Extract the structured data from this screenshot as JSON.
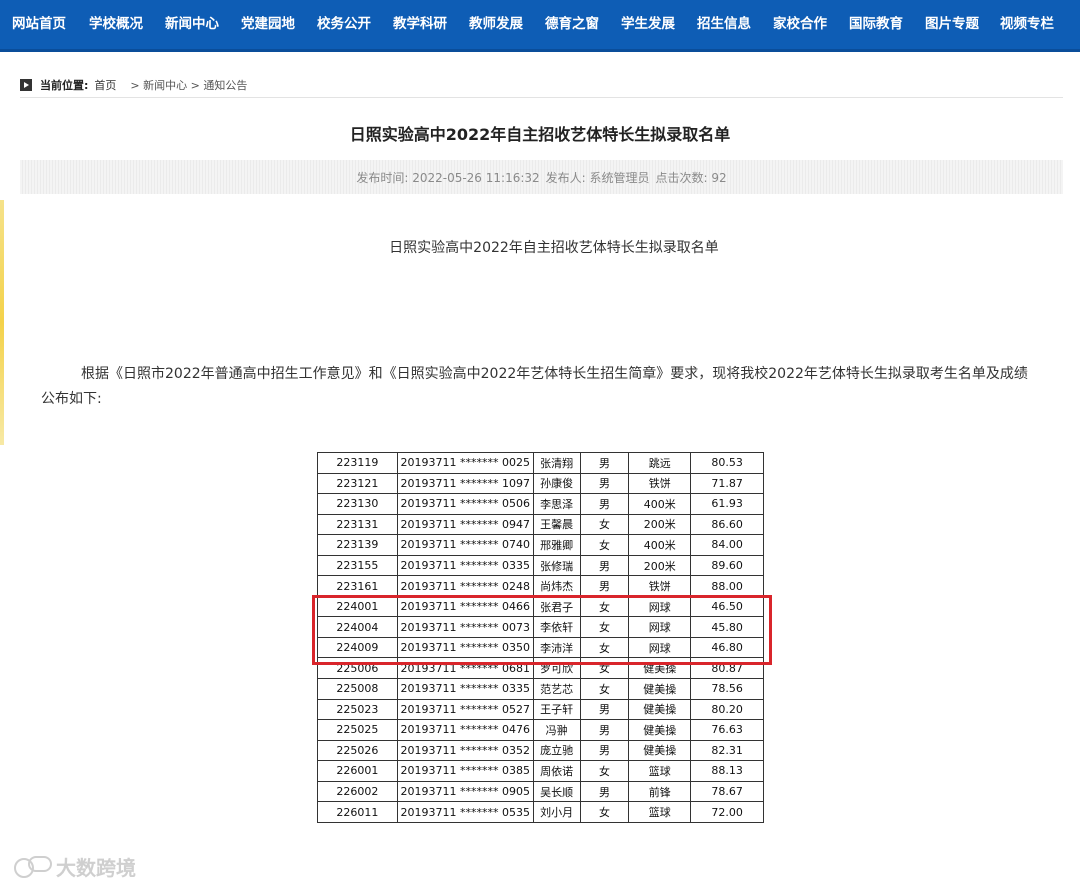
{
  "nav": {
    "items": [
      "网站首页",
      "学校概况",
      "新闻中心",
      "党建园地",
      "校务公开",
      "教学科研",
      "教师发展",
      "德育之窗",
      "学生发展",
      "招生信息",
      "家校合作",
      "国际教育",
      "图片专题",
      "视频专栏"
    ]
  },
  "breadcrumb": {
    "lead": "当前位置:",
    "home": "首页",
    "path": "> 新闻中心 > 通知公告"
  },
  "article": {
    "title": "日照实验高中2022年自主招收艺体特长生拟录取名单",
    "meta": {
      "publish_time": "发布时间: 2022-05-26 11:16:32",
      "publisher": "发布人: 系统管理员",
      "clicks": "点击次数: 92"
    },
    "subtitle": "日照实验高中2022年自主招收艺体特长生拟录取名单",
    "paragraph": "根据《日照市2022年普通高中招生工作意见》和《日照实验高中2022年艺体特长生招生简章》要求，现将我校2022年艺体特长生拟录取考生名单及成绩公布如下:"
  },
  "table": {
    "rows": [
      [
        "223119",
        "20193711 ******* 0025",
        "张清翔",
        "男",
        "跳远",
        "80.53"
      ],
      [
        "223121",
        "20193711 ******* 1097",
        "孙康俊",
        "男",
        "铁饼",
        "71.87"
      ],
      [
        "223130",
        "20193711 ******* 0506",
        "李思泽",
        "男",
        "400米",
        "61.93"
      ],
      [
        "223131",
        "20193711 ******* 0947",
        "王馨晨",
        "女",
        "200米",
        "86.60"
      ],
      [
        "223139",
        "20193711 ******* 0740",
        "邢雅卿",
        "女",
        "400米",
        "84.00"
      ],
      [
        "223155",
        "20193711 ******* 0335",
        "张修瑞",
        "男",
        "200米",
        "89.60"
      ],
      [
        "223161",
        "20193711 ******* 0248",
        "尚炜杰",
        "男",
        "铁饼",
        "88.00"
      ],
      [
        "224001",
        "20193711 ******* 0466",
        "张君子",
        "女",
        "网球",
        "46.50"
      ],
      [
        "224004",
        "20193711 ******* 0073",
        "李依轩",
        "女",
        "网球",
        "45.80"
      ],
      [
        "224009",
        "20193711 ******* 0350",
        "李沛洋",
        "女",
        "网球",
        "46.80"
      ],
      [
        "225006",
        "20193711 ******* 0681",
        "罗可欣",
        "女",
        "健美操",
        "80.87"
      ],
      [
        "225008",
        "20193711 ******* 0335",
        "范艺芯",
        "女",
        "健美操",
        "78.56"
      ],
      [
        "225023",
        "20193711 ******* 0527",
        "王子轩",
        "男",
        "健美操",
        "80.20"
      ],
      [
        "225025",
        "20193711 ******* 0476",
        "冯翀",
        "男",
        "健美操",
        "76.63"
      ],
      [
        "225026",
        "20193711 ******* 0352",
        "庞立驰",
        "男",
        "健美操",
        "82.31"
      ],
      [
        "226001",
        "20193711 ******* 0385",
        "周依诺",
        "女",
        "篮球",
        "88.13"
      ],
      [
        "226002",
        "20193711 ******* 0905",
        "吴长顺",
        "男",
        "前锋",
        "78.67"
      ],
      [
        "226011",
        "20193711 ******* 0535",
        "刘小月",
        "女",
        "篮球",
        "72.00"
      ]
    ]
  },
  "watermark": {
    "text": "大数跨境"
  },
  "colors": {
    "nav_bg": "#0e5db5",
    "highlight": "#d9252b"
  }
}
